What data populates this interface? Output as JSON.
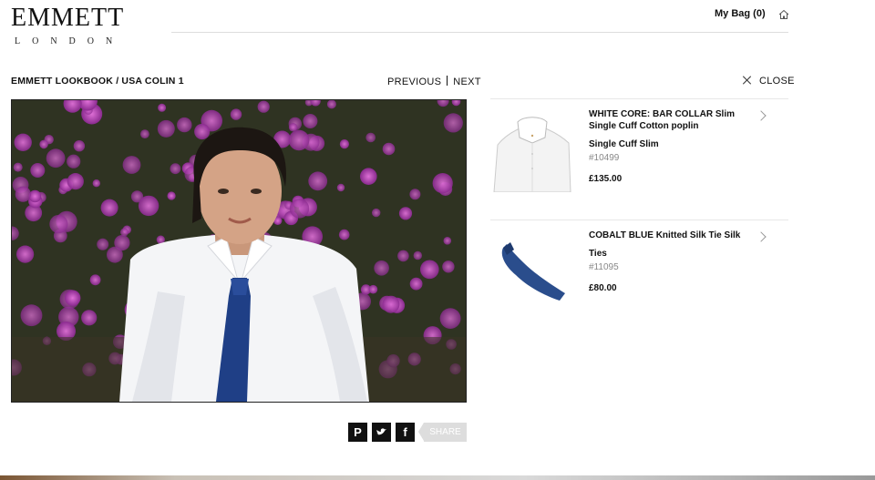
{
  "brand": {
    "name": "EMMETT",
    "subtitle": "LONDON"
  },
  "header": {
    "bag_label": "My Bag (0)",
    "home_icon": "home-icon"
  },
  "breadcrumb": "EMMETT LOOKBOOK / USA COLIN 1",
  "pager": {
    "previous": "PREVIOUS",
    "next": "NEXT"
  },
  "close_label": "CLOSE",
  "share": {
    "label": "SHARE",
    "icons": [
      "pinterest-icon",
      "twitter-icon",
      "facebook-icon"
    ]
  },
  "products": [
    {
      "name": "WHITE CORE: BAR COLLAR Slim Single Cuff Cotton poplin",
      "category": "Single Cuff Slim",
      "sku": "#10499",
      "price": "£135.00"
    },
    {
      "name": "COBALT BLUE Knitted Silk Tie Silk",
      "category": "Ties",
      "sku": "#11095",
      "price": "£80.00"
    }
  ],
  "colors": {
    "text": "#111111",
    "muted": "#888888",
    "tie_blue": "#1f3f86",
    "flowers": "#b43cb8"
  }
}
